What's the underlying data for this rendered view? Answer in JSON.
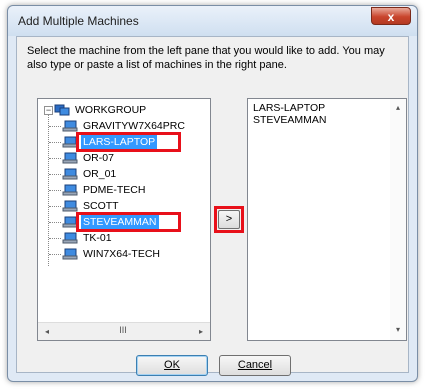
{
  "window": {
    "title": "Add Multiple Machines",
    "close_glyph": "x"
  },
  "instructions": "Select the machine from the left pane that you would like to add.  You may also type or paste a list of machines in the right pane.",
  "tree": {
    "root": "WORKGROUP",
    "items": [
      {
        "label": "GRAVITYW7X64PRC",
        "selected": false
      },
      {
        "label": "LARS-LAPTOP",
        "selected": true
      },
      {
        "label": "OR-07",
        "selected": false
      },
      {
        "label": "OR_01",
        "selected": false
      },
      {
        "label": "PDME-TECH",
        "selected": false
      },
      {
        "label": "SCOTT",
        "selected": false
      },
      {
        "label": "STEVEAMMAN",
        "selected": true
      },
      {
        "label": "TK-01",
        "selected": false
      },
      {
        "label": "WIN7X64-TECH",
        "selected": false
      }
    ],
    "expander": "−",
    "scroll_left": "◂",
    "scroll_grip": "III",
    "scroll_right": "▸"
  },
  "add_button": ">",
  "machine_list": {
    "lines": [
      "LARS-LAPTOP",
      "STEVEAMMAN"
    ],
    "scroll_up": "▴",
    "scroll_down": "▾"
  },
  "buttons": {
    "ok": "OK",
    "cancel": "Cancel"
  },
  "colors": {
    "selection": "#3399ff",
    "highlight_border": "#e8101a"
  }
}
